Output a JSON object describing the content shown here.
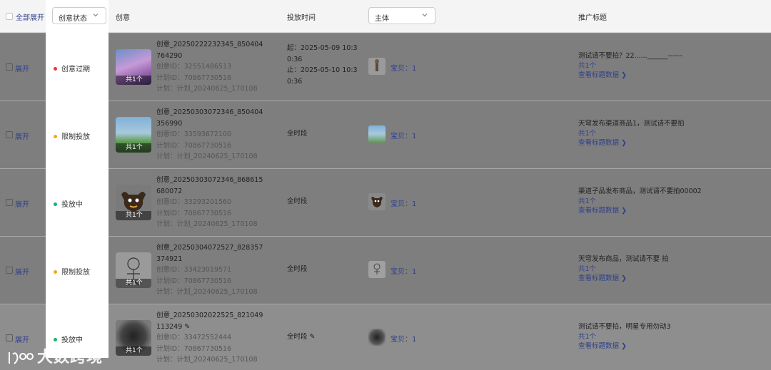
{
  "header": {
    "expand_all": "全部展开",
    "status_select": "创意状态",
    "creative": "创意",
    "time": "投放时间",
    "subject_select": "主体",
    "promo_title": "推广标题"
  },
  "rows": [
    {
      "expand": "展开",
      "status": "创意过期",
      "status_color": "#e8363b",
      "count": "共1个",
      "name_line1": "创意_20250222232345_850404",
      "name_line2": "764290",
      "creative_id": "创意ID：32551486513",
      "plan_id": "计划ID：70867730516",
      "plan": "计划：计划_20240625_170108",
      "time_line1": "起：2025-05-09 10:3",
      "time_line2": "0:36",
      "time_line3": "止：2025-05-10 10:3",
      "time_line4": "0:36",
      "subject": "宝贝：1",
      "promo": "测试请不要拍？22......______------",
      "promo_count": "共1个",
      "promo_link": "查看标题数据"
    },
    {
      "expand": "展开",
      "status": "限制投放",
      "status_color": "#f5a623",
      "count": "共1个",
      "name_line1": "创意_20250303072346_850404",
      "name_line2": "356990",
      "creative_id": "创意ID：33593672100",
      "plan_id": "计划ID：70867730516",
      "plan": "计划：计划_20240625_170108",
      "time_line1": "全时段",
      "subject": "宝贝：1",
      "promo": "天穹发布渠道商品1，测试请不要拍",
      "promo_count": "共1个",
      "promo_link": "查看标题数据"
    },
    {
      "expand": "展开",
      "status": "投放中",
      "status_color": "#19b36b",
      "count": "共1个",
      "name_line1": "创意_20250303072346_868615",
      "name_line2": "680072",
      "creative_id": "创意ID：33293201560",
      "plan_id": "计划ID：70867730516",
      "plan": "计划：计划_20240625_170108",
      "time_line1": "全时段",
      "subject": "宝贝：1",
      "promo": "渠道子品发布商品，测试请不要拍00002",
      "promo_count": "共1个",
      "promo_link": "查看标题数据"
    },
    {
      "expand": "展开",
      "status": "限制投放",
      "status_color": "#f5a623",
      "count": "共1个",
      "name_line1": "创意_20250304072527_828357",
      "name_line2": "374921",
      "creative_id": "创意ID：33423019571",
      "plan_id": "计划ID：70867730516",
      "plan": "计划：计划_20240625_170108",
      "time_line1": "全时段",
      "subject": "宝贝：1",
      "promo": "天穹发布商品，测试请不要 拍",
      "promo_count": "共1个",
      "promo_link": "查看标题数据"
    },
    {
      "expand": "展开",
      "status": "投放中",
      "status_color": "#19b36b",
      "count": "共1个",
      "name_line1": "创意_20250302022525_821049",
      "name_line2": "113249",
      "creative_id": "创意ID：33472552444",
      "plan_id": "计划ID：70867730516",
      "plan": "计划：计划_20240625_170108",
      "time_line1": "全时段",
      "subject": "宝贝：1",
      "promo": "测试请不要拍，明星专用勿动3",
      "promo_count": "共1个",
      "promo_link": "查看标题数据"
    }
  ],
  "watermark": "大数跨境"
}
